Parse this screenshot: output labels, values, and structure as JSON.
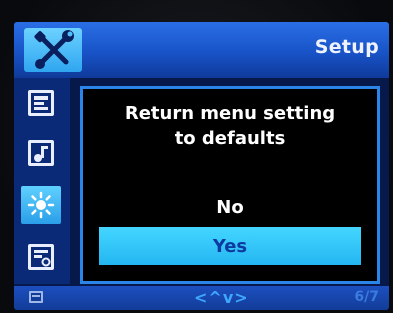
{
  "header": {
    "title": "Setup",
    "icon": "wrench-screwdriver-icon"
  },
  "sidebar": {
    "items": [
      {
        "icon": "display-frame-icon",
        "selected": false
      },
      {
        "icon": "music-note-icon",
        "selected": false
      },
      {
        "icon": "brightness-sun-icon",
        "selected": true
      },
      {
        "icon": "settings-card-icon",
        "selected": false
      }
    ]
  },
  "dialog": {
    "message": "Return menu setting\nto defaults",
    "options": {
      "no": "No",
      "yes": "Yes"
    },
    "selected_option": "Yes"
  },
  "footer": {
    "nav_symbols": "<^v>",
    "page_indicator": "6/7",
    "icon": "card-icon"
  },
  "colors": {
    "header_blue": "#1853c7",
    "selection_cyan": "#36c6f8",
    "dialog_border": "#2b84e8",
    "screen_bg": "#07184a"
  }
}
